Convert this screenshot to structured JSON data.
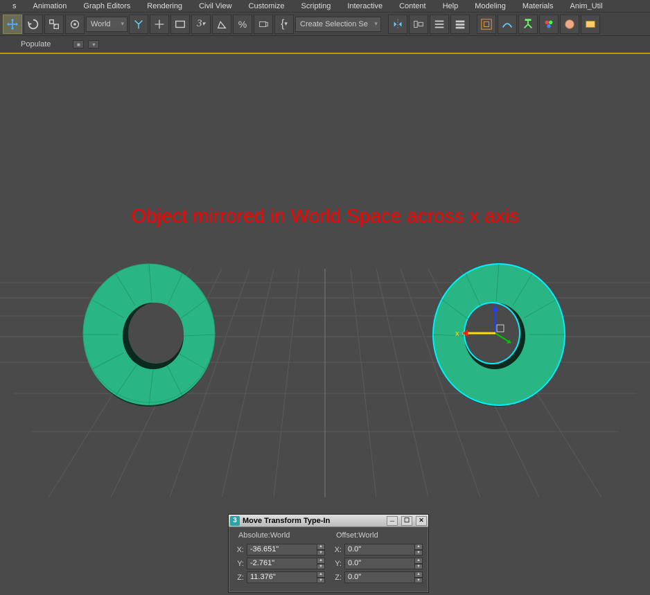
{
  "menubar": {
    "items": [
      "s",
      "Animation",
      "Graph Editors",
      "Rendering",
      "Civil View",
      "Customize",
      "Scripting",
      "Interactive",
      "Content",
      "Help",
      "Modeling",
      "Materials",
      "Anim_Util"
    ]
  },
  "toolbar1": {
    "coord_system": "World",
    "selection_set": "Create Selection Se"
  },
  "toolbar2": {
    "label": "Populate"
  },
  "annotation": "Object mirrored in World Space across x axis",
  "dialog": {
    "title": "Move Transform Type-In",
    "logo": "3",
    "absolute": {
      "header": "Absolute:World",
      "x": "-36.651\"",
      "y": "-2.761\"",
      "z": "11.376\""
    },
    "offset": {
      "header": "Offset:World",
      "x": "0.0\"",
      "y": "0.0\"",
      "z": "0.0\""
    }
  }
}
